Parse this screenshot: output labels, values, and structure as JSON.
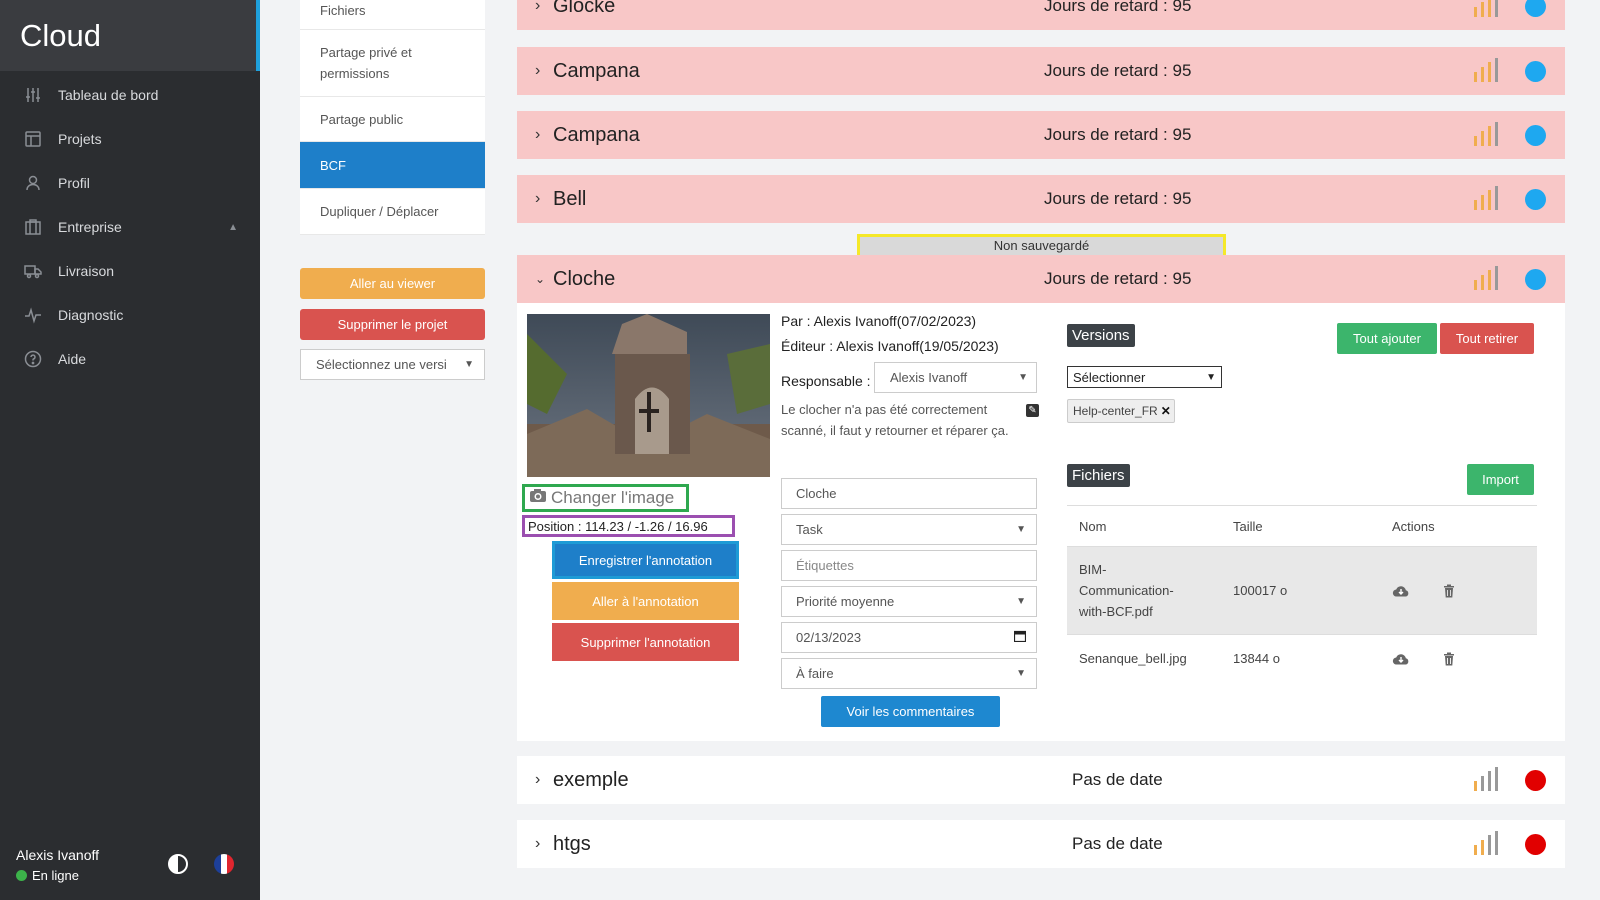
{
  "sidebar": {
    "brand": "Cloud",
    "items": [
      {
        "label": "Tableau de bord",
        "icon": "sliders-icon"
      },
      {
        "label": "Projets",
        "icon": "layout-icon"
      },
      {
        "label": "Profil",
        "icon": "user-icon"
      },
      {
        "label": "Entreprise",
        "icon": "building-icon"
      },
      {
        "label": "Livraison",
        "icon": "truck-icon"
      },
      {
        "label": "Diagnostic",
        "icon": "pulse-icon"
      },
      {
        "label": "Aide",
        "icon": "help-icon"
      }
    ],
    "user": {
      "name": "Alexis Ivanoff",
      "status": "En ligne"
    }
  },
  "submenu": {
    "items": [
      "Fichiers",
      "Partage privé et permissions",
      "Partage public",
      "BCF",
      "Dupliquer / Déplacer"
    ],
    "active": "BCF",
    "viewer_button": "Aller au viewer",
    "delete_button": "Supprimer le projet",
    "version_select": "Sélectionnez une versi"
  },
  "topics": [
    {
      "title": "Glocke",
      "status": "Jours de retard : 95",
      "dot": "#1ea8f0"
    },
    {
      "title": "Campana",
      "status": "Jours de retard : 95",
      "dot": "#1ea8f0"
    },
    {
      "title": "Campana",
      "status": "Jours de retard : 95",
      "dot": "#1ea8f0"
    },
    {
      "title": "Bell",
      "status": "Jours de retard : 95",
      "dot": "#1ea8f0"
    },
    {
      "title": "Cloche",
      "status": "Jours de retard : 95",
      "dot": "#1ea8f0"
    },
    {
      "title": "exemple",
      "status": "Pas de date",
      "dot": "#e10000"
    },
    {
      "title": "htgs",
      "status": "Pas de date",
      "dot": "#e10000"
    }
  ],
  "unsaved_label": "Non sauvegardé",
  "detail": {
    "change_image": "Changer l'image",
    "position": "Position : 114.23 / -1.26 / 16.96",
    "save_annotation": "Enregistrer l'annotation",
    "goto_annotation": "Aller à l'annotation",
    "delete_annotation": "Supprimer l'annotation",
    "author": "Par : Alexis Ivanoff(07/02/2023)",
    "editor": "Éditeur : Alexis Ivanoff(19/05/2023)",
    "responsable_label": "Responsable :",
    "responsable_value": "Alexis Ivanoff",
    "description": "Le clocher n'a pas été correctement scanné, il faut y retourner et réparer ça.",
    "title_value": "Cloche",
    "type_value": "Task",
    "tags_placeholder": "Étiquettes",
    "priority_value": "Priorité moyenne",
    "date_value": "02/13/2023",
    "status_value": "À faire",
    "comments_button": "Voir les commentaires",
    "versions_title": "Versions",
    "add_all": "Tout ajouter",
    "remove_all": "Tout retirer",
    "versions_select": "Sélectionner",
    "version_chip": "Help-center_FR",
    "files_title": "Fichiers",
    "import_button": "Import",
    "files_headers": [
      "Nom",
      "Taille",
      "Actions"
    ],
    "files": [
      {
        "name": "BIM-Communication-with-BCF.pdf",
        "size": "100017 o"
      },
      {
        "name": "Senanque_bell.jpg",
        "size": "13844 o"
      }
    ]
  }
}
